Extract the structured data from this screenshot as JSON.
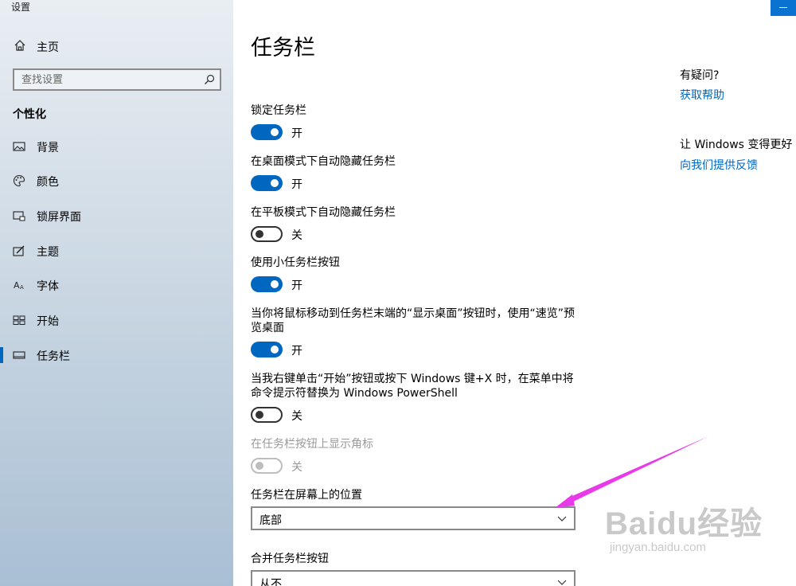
{
  "window": {
    "title": "设置"
  },
  "sidebar": {
    "home_label": "主页",
    "search_placeholder": "查找设置",
    "section_title": "个性化",
    "items": [
      {
        "label": "背景",
        "icon": "picture-icon"
      },
      {
        "label": "颜色",
        "icon": "palette-icon"
      },
      {
        "label": "锁屏界面",
        "icon": "lock-screen-icon"
      },
      {
        "label": "主题",
        "icon": "theme-brush-icon"
      },
      {
        "label": "字体",
        "icon": "font-icon"
      },
      {
        "label": "开始",
        "icon": "start-grid-icon"
      },
      {
        "label": "任务栏",
        "icon": "taskbar-icon",
        "active": true
      }
    ]
  },
  "main": {
    "title": "任务栏",
    "settings": [
      {
        "label": "锁定任务栏",
        "state": "开",
        "on": true
      },
      {
        "label": "在桌面模式下自动隐藏任务栏",
        "state": "开",
        "on": true
      },
      {
        "label": "在平板模式下自动隐藏任务栏",
        "state": "关",
        "on": false
      },
      {
        "label": "使用小任务栏按钮",
        "state": "开",
        "on": true
      },
      {
        "label": "当你将鼠标移动到任务栏末端的“显示桌面”按钮时，使用“速览”预览桌面",
        "state": "开",
        "on": true
      },
      {
        "label": "当我右键单击“开始”按钮或按下 Windows 键+X 时，在菜单中将命令提示符替换为 Windows PowerShell",
        "state": "关",
        "on": false
      },
      {
        "label": "在任务栏按钮上显示角标",
        "state": "关",
        "on": false,
        "disabled": true
      }
    ],
    "position": {
      "label": "任务栏在屏幕上的位置",
      "value": "底部"
    },
    "combine": {
      "label": "合并任务栏按钮",
      "value": "从不"
    }
  },
  "help": {
    "question": "有疑问?",
    "get_help": "获取帮助",
    "improve": "让 Windows 变得更好",
    "feedback": "向我们提供反馈"
  },
  "watermark": {
    "main": "Baidu经验",
    "sub": "jingyan.baidu.com"
  },
  "colors": {
    "accent": "#0067c0",
    "annotation_arrow": "#e83ae8"
  }
}
